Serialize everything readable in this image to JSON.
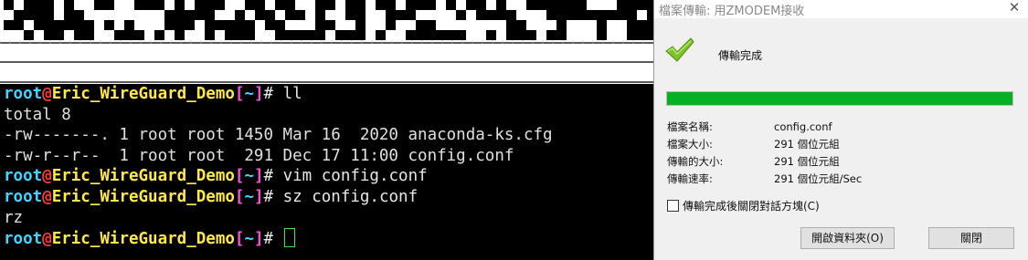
{
  "terminal": {
    "prompt": {
      "user": "root",
      "at": "@",
      "host": "Eric_WireGuard_Demo",
      "open": "[",
      "path": "~",
      "close": "]",
      "hash": "#"
    },
    "lines": [
      {
        "type": "prompt",
        "cmd": " ll"
      },
      {
        "type": "output",
        "text": "total 8"
      },
      {
        "type": "output",
        "text": "-rw-------. 1 root root 1450 Mar 16  2020 anaconda-ks.cfg"
      },
      {
        "type": "output",
        "text": "-rw-r--r--  1 root root  291 Dec 17 11:00 config.conf"
      },
      {
        "type": "prompt",
        "cmd": " vim config.conf"
      },
      {
        "type": "prompt",
        "cmd": " sz config.conf"
      },
      {
        "type": "output",
        "text": "rz"
      },
      {
        "type": "prompt",
        "cmd": " "
      }
    ]
  },
  "dialog": {
    "title": "檔案傳輸: 用ZMODEM接收",
    "close_glyph": "✕",
    "status": "傳輸完成",
    "progress": 1.0,
    "progress_color": "#06b025",
    "info": [
      {
        "label": "檔案名稱:",
        "value": "config.conf"
      },
      {
        "label": "檔案大小:",
        "value": "291 個位元組"
      },
      {
        "label": "傳輸的大小:",
        "value": "291 個位元組"
      },
      {
        "label": "傳輸速率:",
        "value": "291 個位元組/Sec"
      }
    ],
    "close_after_label": "傳輸完成後關閉對話方塊(C)",
    "close_after_checked": false,
    "open_folder_label": "開啟資料夾(O)",
    "close_label": "關閉"
  }
}
